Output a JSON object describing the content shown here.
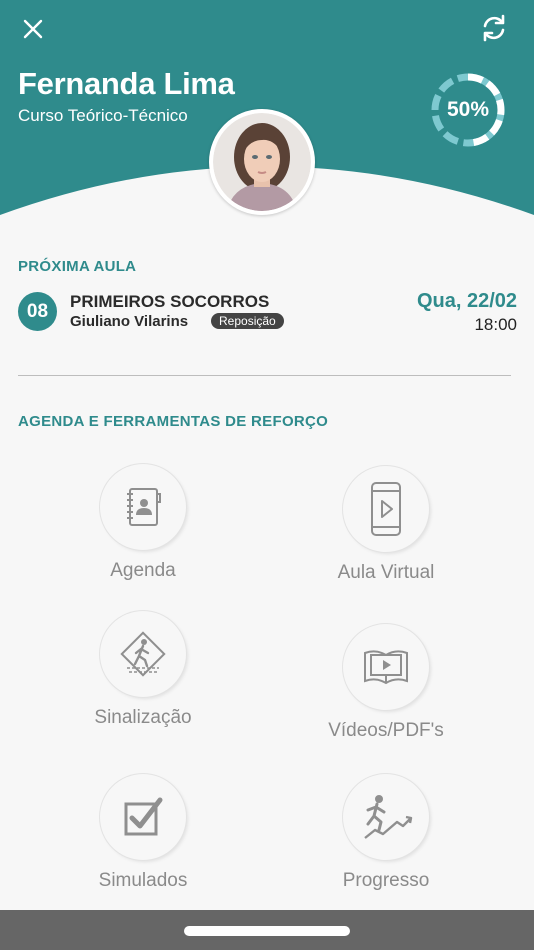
{
  "header": {
    "user_name": "Fernanda Lima",
    "course": "Curso Teórico-Técnico",
    "progress_label": "50%",
    "progress_fraction": 0.5,
    "colors": {
      "teal": "#2f8b8c",
      "ring_track": "#7ec9d0",
      "ring_fill": "#ffffff"
    },
    "close_icon": "close-icon",
    "refresh_icon": "refresh-icon"
  },
  "next_lesson": {
    "section_title": "PRÓXIMA AULA",
    "number": "08",
    "title": "PRIMEIROS SOCORROS",
    "instructor": "Giuliano Vilarins",
    "badge": "Reposição",
    "date": "Qua, 22/02",
    "time": "18:00"
  },
  "tools": {
    "section_title": "AGENDA E FERRAMENTAS DE REFORÇO",
    "items": [
      {
        "label": "Agenda",
        "icon": "agenda-icon"
      },
      {
        "label": "Aula Virtual",
        "icon": "phone-video-icon"
      },
      {
        "label": "Sinalização",
        "icon": "pedestrian-sign-icon"
      },
      {
        "label": "Vídeos/PDF's",
        "icon": "book-video-icon"
      },
      {
        "label": "Simulados",
        "icon": "checkbox-icon"
      },
      {
        "label": "Progresso",
        "icon": "progress-runner-icon"
      }
    ]
  }
}
